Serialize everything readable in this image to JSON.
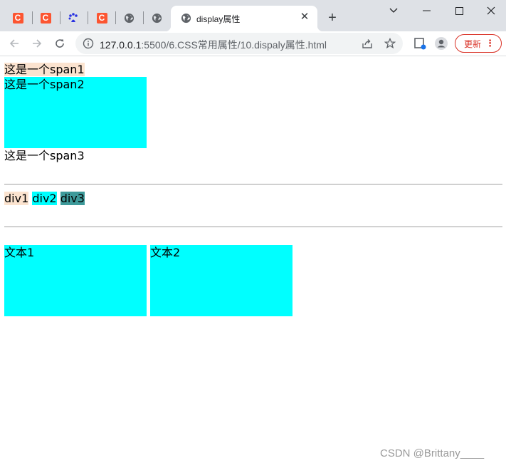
{
  "browser": {
    "pinned_tabs": [
      {
        "icon": "csdn-icon",
        "glyph": "C"
      },
      {
        "icon": "csdn-icon",
        "glyph": "C"
      },
      {
        "icon": "baidu-paw-icon",
        "glyph": "🐾"
      },
      {
        "icon": "csdn-icon",
        "glyph": "C"
      },
      {
        "icon": "globe-icon",
        "glyph": ""
      },
      {
        "icon": "globe-icon",
        "glyph": ""
      }
    ],
    "active_tab": {
      "title": "display属性",
      "icon": "globe-icon",
      "close_glyph": "✕"
    },
    "new_tab_glyph": "+",
    "window_controls": {
      "chevron": "⌄",
      "minimize": "—",
      "maximize": "☐",
      "close": "✕"
    },
    "url_host": "127.0.0.1",
    "url_rest": ":5500/6.CSS常用属性/10.dispaly属性.html",
    "update_label": "更新",
    "menu_glyph": "⋮"
  },
  "page": {
    "span1": "这是一个span1",
    "span2": "这是一个span2",
    "span3": "这是一个span3",
    "div1": "div1",
    "div2": "div2",
    "div3": "div3",
    "box1": "文本1",
    "box2": "文本2"
  },
  "watermark": "CSDN @Brittany____",
  "colors": {
    "tab_strip": "#dee1e6",
    "peach": "#fbe3cf",
    "cyan": "#00ffff",
    "teal": "#3d9a9a",
    "update_red": "#d93025"
  }
}
